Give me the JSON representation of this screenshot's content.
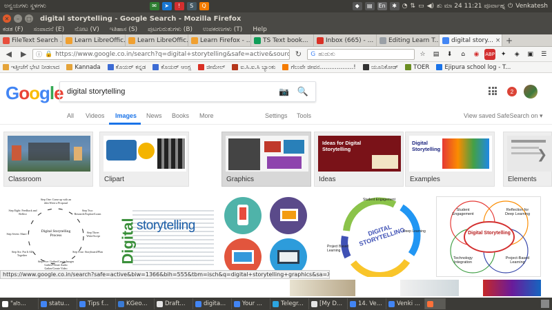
{
  "panel": {
    "app_title": "ಅನ್ವಯಗಳು  ಸ್ಥಳಗಳು",
    "tray_items": [
      "En"
    ],
    "clock": "ಶು ಮಾ 24 11:21 ಪೂರ್ವಾಹ್ನ",
    "user": "Venkatesh"
  },
  "window": {
    "title": "digital storytelling - Google Search - Mozilla Firefox"
  },
  "menu": [
    "ಕಡತ (F)",
    "ಸಂಪಾದನೆ (E)",
    "ನೋಟ (V)",
    "ಇತಿಹಾಸ (S)",
    "ಪುಟಗುರುತುಗಳು (B)",
    "ಉಪಕರಣಗಳು (T)",
    "Help"
  ],
  "tabs": [
    {
      "label": "FileText Search ...",
      "color": "#e84e3c"
    },
    {
      "label": "Learn LibreOffic...",
      "color": "#f0a030"
    },
    {
      "label": "Learn LibreOffic...",
      "color": "#f0a030"
    },
    {
      "label": "Learn Firefox - ...",
      "color": "#f0a030"
    },
    {
      "label": "TS Text book...",
      "color": "#0f9d58"
    },
    {
      "label": "Inbox (665) - ...",
      "color": "#d93025"
    },
    {
      "label": "Editing Learn T...",
      "color": "#9aa0a6"
    },
    {
      "label": "digital story...",
      "color": "#4285f4"
    }
  ],
  "tab_close": "×",
  "new_tab": "+",
  "nav": {
    "url": "https://www.google.co.in/search?q=digital+storytelling&safe=active&source=lnms&tb",
    "search_placeholder": "ಹುಡುಕು",
    "extensions": [
      "ABP"
    ]
  },
  "bookmarks": [
    {
      "label": "ಇತ್ತೀಚೆಗೆ ಭೇಟಿ ನೀಡಲಾದ",
      "color": "#e5a43a"
    },
    {
      "label": "Kannada",
      "color": "#e5a43a"
    },
    {
      "label": "ಕೊಯರ್ ಕನ್ನಡ",
      "color": "#3c6bd4"
    },
    {
      "label": "ಕೊಯರ್ ಆಂಗ್ಲ",
      "color": "#3c6bd4"
    },
    {
      "label": "ಜೀಮೇಲ್",
      "color": "#d93025"
    },
    {
      "label": "ಐ.ಸಿ.ಐ.ಸಿ ಬ್ಯಾಂಕು",
      "color": "#b5361b"
    },
    {
      "label": "ಗೆಲುವೇ ಜೀವನ..................!",
      "color": "#f57c00"
    },
    {
      "label": "ಯೂನಿಕೋಡ್",
      "color": "#333333"
    },
    {
      "label": "TOER",
      "color": "#6b8e23"
    },
    {
      "label": "Ejipura school log - T...",
      "color": "#1a73e8"
    }
  ],
  "google": {
    "query": "digital storytelling",
    "notifications": "2",
    "tabs": [
      "All",
      "Videos",
      "Images",
      "News",
      "Books",
      "More"
    ],
    "tools": [
      "Settings",
      "Tools"
    ],
    "right": [
      "View saved",
      "SafeSearch on ▾"
    ]
  },
  "chips": [
    "Classroom",
    "Clipart",
    "Graphics",
    "Ideas",
    "Examples",
    "Elements"
  ],
  "chip_texts": {
    "ideas_title": "Ideas for Digital Storytelling",
    "examples_title": "Digital Storytelling"
  },
  "results": {
    "process": {
      "title": "Digital Storytelling Process",
      "steps": [
        "Step One: Come up with an idea Write a Proposal",
        "Step Two: Research/Explore/Learn",
        "Step Three: Write/Script",
        "Step Four: Storyboard/Plan",
        "Step Five: Gather/Create Images Gather/Create Audio Gather/Create Video",
        "Step Six: Put It All Together",
        "Step Seven: Share",
        "Step Eight: Feedback and Reflect"
      ]
    },
    "cloud": {
      "word1": "storytelling",
      "word2": "Digital"
    },
    "cycle": {
      "center": "DIGITAL STORYTELLING",
      "labels": [
        "Student Engagement",
        "Deep Learning",
        "Project Based Learning"
      ]
    },
    "venn": {
      "center": "Digital Storytelling",
      "labels": [
        "Student Engagement",
        "Reflection for Deep Learning",
        "Technology Integration",
        "Project-Based Learning"
      ]
    }
  },
  "status_url": "https://www.google.co.in/search?safe=active&biw=1366&bih=555&tbm=isch&q=digital+storytelling+graphics&sa=X&ved=0ahUKEwj4xJyPse7SAhWDppQKHaiKAQsQhyYIIA",
  "taskbar": [
    {
      "label": "\"ಹೆರಿ...",
      "color": "#ffffff"
    },
    {
      "label": "statu...",
      "color": "#4285f4"
    },
    {
      "label": "Tips f...",
      "color": "#4285f4"
    },
    {
      "label": "KGeo...",
      "color": "#3a7bd5"
    },
    {
      "label": "Draft...",
      "color": "#e5e5e5"
    },
    {
      "label": "digita...",
      "color": "#4285f4"
    },
    {
      "label": "Your ...",
      "color": "#4285f4"
    },
    {
      "label": "Telegr...",
      "color": "#2ca5e0"
    },
    {
      "label": "[My D...",
      "color": "#e5e5e5"
    },
    {
      "label": "14. Ve...",
      "color": "#4285f4"
    },
    {
      "label": "Venki ...",
      "color": "#4285f4"
    },
    {
      "label": "",
      "color": "#ff7139"
    }
  ]
}
